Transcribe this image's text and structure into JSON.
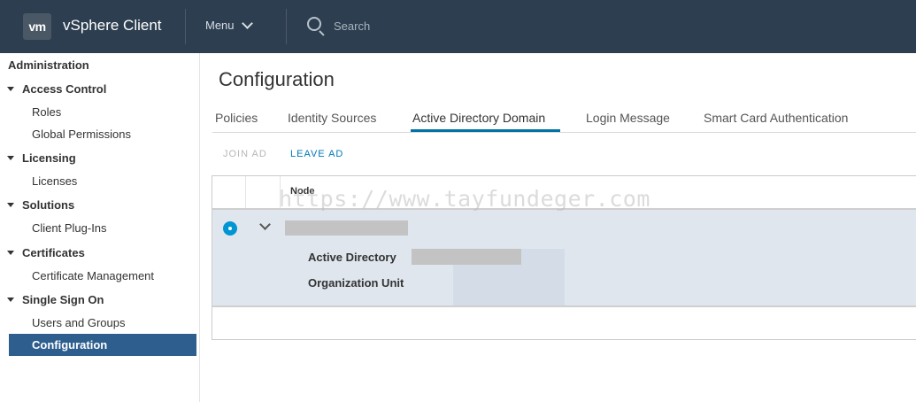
{
  "header": {
    "logo_text": "vm",
    "app_title": "vSphere Client",
    "menu_label": "Menu",
    "search_placeholder": "Search"
  },
  "sidebar": {
    "title": "Administration",
    "sections": [
      {
        "label": "Access Control",
        "items": [
          "Roles",
          "Global Permissions"
        ]
      },
      {
        "label": "Licensing",
        "items": [
          "Licenses"
        ]
      },
      {
        "label": "Solutions",
        "items": [
          "Client Plug-Ins"
        ]
      },
      {
        "label": "Certificates",
        "items": [
          "Certificate Management"
        ]
      },
      {
        "label": "Single Sign On",
        "items": [
          "Users and Groups",
          "Configuration"
        ]
      }
    ],
    "active_item": "Configuration"
  },
  "main": {
    "page_title": "Configuration",
    "tabs": [
      "Policies",
      "Identity Sources",
      "Active Directory Domain",
      "Login Message",
      "Smart Card Authentication"
    ],
    "active_tab": "Active Directory Domain",
    "actions": {
      "join": "JOIN AD",
      "leave": "LEAVE AD"
    },
    "grid": {
      "column_node": "Node",
      "details": {
        "active_directory": "Active Directory",
        "organization_unit": "Organization Unit"
      }
    }
  },
  "watermark": "https://www.tayfundeger.com",
  "colors": {
    "header_bg": "#2d3e50",
    "active_item_bg": "#2d5e8e",
    "accent": "#0072a3",
    "selected_row": "#dfe6ee"
  }
}
